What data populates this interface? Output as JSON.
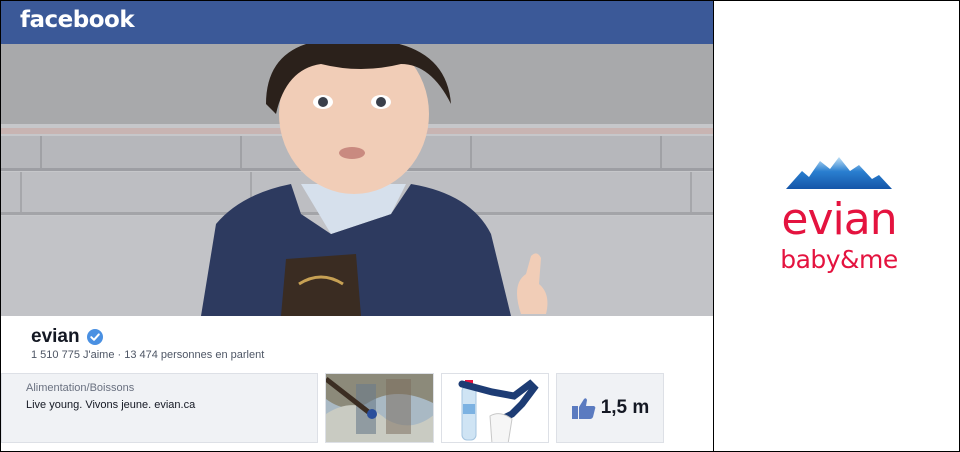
{
  "header": {
    "logo": "facebook"
  },
  "page": {
    "name": "evian",
    "stats": "1 510 775 J'aime · 13 474 personnes en parlent",
    "category": "Alimentation/Boissons",
    "tagline": "Live young. Vivons jeune. evian.ca",
    "likes_summary": "1,5 m"
  },
  "brand": {
    "wordmark": "evian",
    "subline": "baby&me"
  },
  "icons": [
    "verified-badge-icon",
    "thumbs-up-icon"
  ],
  "colors": {
    "facebook_blue": "#3b5998",
    "evian_red": "#e4133f",
    "mountain_blue": "#2a7fd0"
  }
}
